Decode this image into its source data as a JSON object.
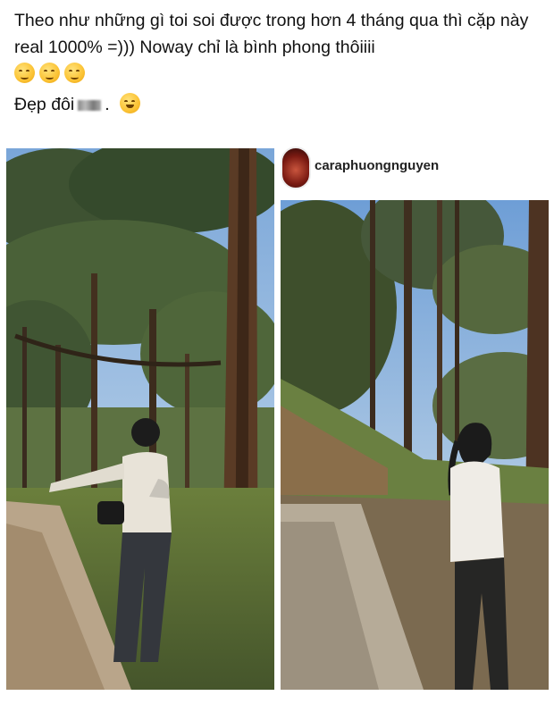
{
  "post": {
    "caption_line1": "Theo như những gì toi soi được trong hơn 4 tháng qua thì cặp này real 1000% =))) Noway chỉ là bình phong thôiiii",
    "caption_line2_prefix": "Đẹp đôi",
    "caption_line2_suffix": ".",
    "emojis": [
      "relieved-face",
      "relieved-face",
      "relieved-face",
      "grinning-squinting-face"
    ]
  },
  "instagram": {
    "username": "caraphuongnguyen"
  },
  "colors": {
    "sky": "#8fb8e6",
    "forest_dark": "#2f3b26",
    "path": "#b9a58a",
    "text": "#111111"
  }
}
